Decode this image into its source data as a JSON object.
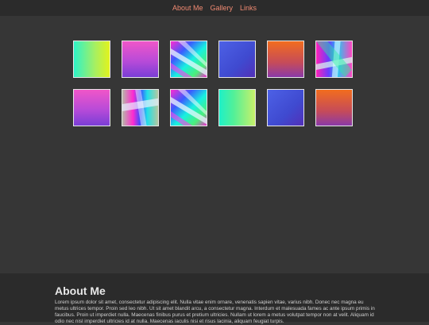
{
  "nav": {
    "links": [
      "About Me",
      "Gallery",
      "Links"
    ]
  },
  "gallery": {
    "thumbnails": [
      {
        "style": "lime-gradient"
      },
      {
        "style": "pink-purple-gradient"
      },
      {
        "style": "rainbow-streak"
      },
      {
        "style": "blue-gradient"
      },
      {
        "style": "orange-purple-gradient"
      },
      {
        "style": "rainbow-streak"
      },
      {
        "style": "pink-purple-gradient"
      },
      {
        "style": "rainbow-streak"
      },
      {
        "style": "rainbow-streak"
      },
      {
        "style": "cyan-lime-gradient"
      },
      {
        "style": "blue-gradient"
      },
      {
        "style": "orange-purple-gradient"
      }
    ]
  },
  "about": {
    "title": "About Me",
    "text": "Lorem ipsum dolor sit amet, consectetur adipiscing elit. Nulla vitae enim ornare, venenatis sapien vitae, varius nibh. Donec nec magna eu metus ultrices tempor. Proin sed leo nibh. Ut sit amet blandit arcu, a consectetur magna. Interdum et malesuada fames ac ante ipsum primis in faucibus. Proin ut imperdiet nulla. Maecenas finibus purus et pretium ultricies. Nullam ut lorem a metus volutpat tempor non at velit. Aliquam id odio nec nisl imperdiet ultricies id at nulla. Maecenas iaculis nisi et risus lacinia, aliquam feugiat turpis."
  },
  "colors": {
    "nav_link": "#f08a72",
    "background": "#363636",
    "bar": "#2b2b2b",
    "thumb_border": "#e6e6e6"
  }
}
